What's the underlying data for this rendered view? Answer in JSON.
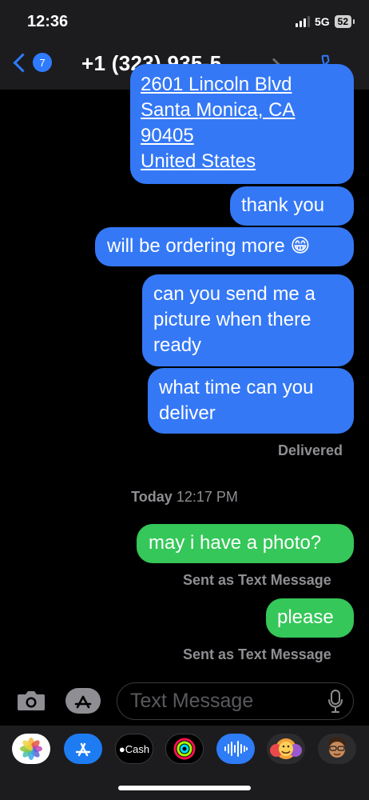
{
  "status": {
    "time": "12:36",
    "network": "5G",
    "battery": "52"
  },
  "nav": {
    "back_badge": "7",
    "contact": "+1 (323) 935-5…"
  },
  "messages": {
    "address": {
      "line1": "2601 Lincoln Blvd",
      "line2": "Santa Monica, CA",
      "line3": "90405",
      "line4": "United States"
    },
    "m1": "thank you",
    "m2": "will be ordering more 😁",
    "m3": "can you send me a picture when there ready",
    "m4": "what time can you deliver",
    "delivered": "Delivered",
    "timestamp_day": "Today",
    "timestamp_time": "12:17 PM",
    "m5": "may i have a photo?",
    "sent_note_1": "Sent as Text Message",
    "m6": "please",
    "sent_note_2": "Sent as Text Message"
  },
  "composer": {
    "placeholder": "Text Message"
  },
  "drawer": {
    "apps": [
      "photos-app",
      "app-store",
      "cash",
      "fitness-activity",
      "audio-message",
      "memoji-stickers",
      "memoji"
    ],
    "cash_label": "Cash"
  },
  "colors": {
    "imessage_blue": "#3478f6",
    "sms_green": "#35c759",
    "accent": "#2f7bff"
  }
}
